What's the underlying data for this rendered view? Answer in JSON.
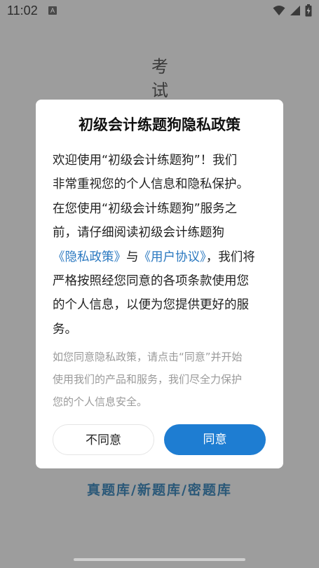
{
  "status": {
    "time": "11:02",
    "notification_badge": "A"
  },
  "background": {
    "title_chars": [
      "考",
      "试"
    ],
    "footer": "真题库/新题库/密题库"
  },
  "dialog": {
    "title": "初级会计练题狗隐私政策",
    "body": {
      "line1": "欢迎使用“初级会计练题狗”！我们",
      "line2": "非常重视您的个人信息和隐私保护。",
      "line3": "在您使用“初级会计练题狗”服务之",
      "line4": "前，请仔细阅读初级会计练题狗",
      "privacy_link": "《隐私政策》",
      "and": "与",
      "user_link": "《用户协议》",
      "line5_tail": "，我们将",
      "line6": "严格按照经您同意的各项条款使用您",
      "line7": "的个人信息，以便为您提供更好的服",
      "line8": "务。"
    },
    "note": {
      "line1": "如您同意隐私政策，请点击“同意”并开始",
      "line2": "使用我们的产品和服务，我们尽全力保护",
      "line3": "您的个人信息安全。"
    },
    "disagree_label": "不同意",
    "agree_label": "同意"
  },
  "colors": {
    "agree_button": "#1e7dd2",
    "link": "#2a78c0",
    "footer_text": "#2a5878",
    "overlay": "#9d9d9d"
  }
}
